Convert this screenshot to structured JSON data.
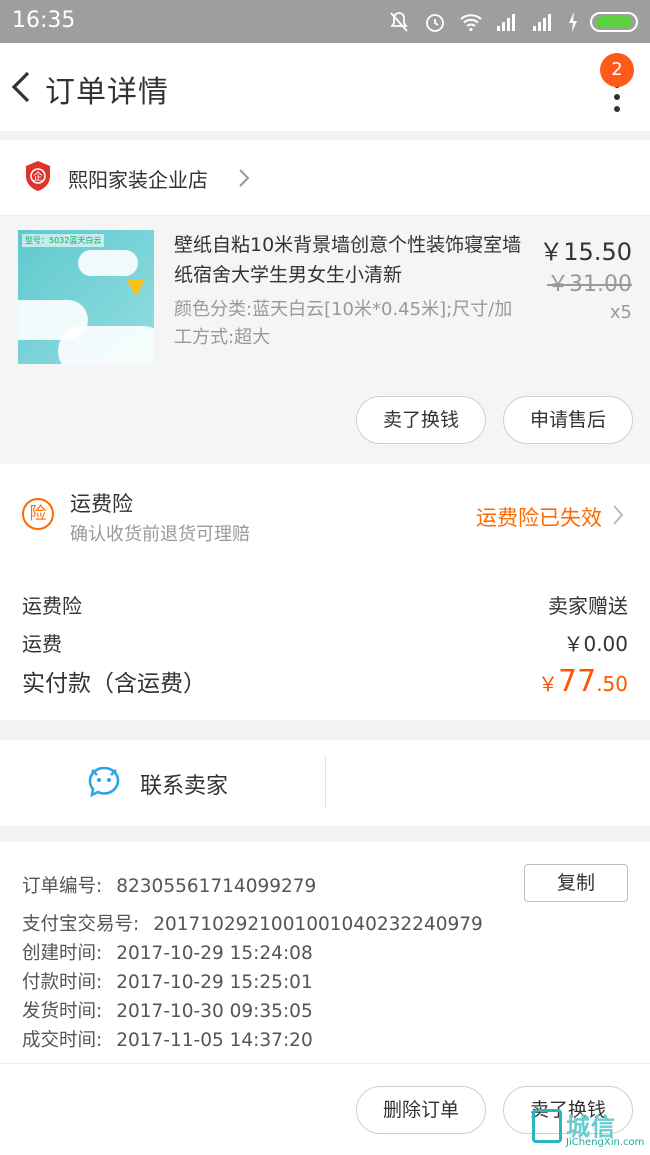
{
  "status_bar": {
    "time": "16:35"
  },
  "header": {
    "title": "订单详情",
    "badge_count": "2"
  },
  "store": {
    "name": "熙阳家装企业店"
  },
  "product": {
    "title": "壁纸自粘10米背景墙创意个性装饰寝室墙纸宿舍大学生男女生小清新",
    "spec": "颜色分类:蓝天白云[10米*0.45米];尺寸/加工方式:超大",
    "price": "￥15.50",
    "original_price": "￥31.00",
    "quantity": "x5",
    "thumbnail_tag": "型号：5032蓝天白云",
    "actions": [
      "卖了换钱",
      "申请售后"
    ]
  },
  "insurance": {
    "title": "运费险",
    "subtitle": "确认收货前退货可理赔",
    "status": "运费险已失效"
  },
  "fees": [
    {
      "label": "运费险",
      "value": "卖家赠送"
    },
    {
      "label": "运费",
      "value": "￥0.00"
    }
  ],
  "total": {
    "label": "实付款（含运费）",
    "currency": "￥",
    "integer": "77",
    "decimal": ".50"
  },
  "contact": {
    "label": "联系卖家"
  },
  "order_info": {
    "copy_label": "复制",
    "rows": [
      {
        "key": "订单编号:",
        "value": "82305561714099279"
      },
      {
        "key": "支付宝交易号:",
        "value": "2017102921001001040232240979"
      },
      {
        "key": "创建时间:",
        "value": "2017-10-29 15:24:08"
      },
      {
        "key": "付款时间:",
        "value": "2017-10-29 15:25:01"
      },
      {
        "key": "发货时间:",
        "value": "2017-10-30 09:35:05"
      },
      {
        "key": "成交时间:",
        "value": "2017-11-05 14:37:20"
      }
    ]
  },
  "bottom_actions": [
    "删除订单",
    "卖了换钱"
  ],
  "watermark": {
    "text": "城信",
    "sub": "JiChengXin.com"
  },
  "colors": {
    "accent": "#ff5500",
    "badge": "#ff5a19",
    "statusbar": "#9e9e9e"
  }
}
